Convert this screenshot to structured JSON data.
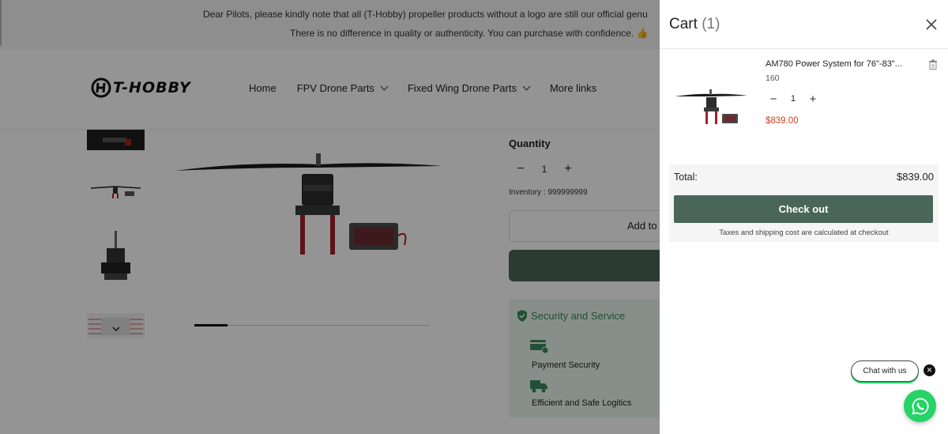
{
  "announcement": {
    "line1": "Dear Pilots, please kindly note that all (T-Hobby) propeller products without a logo are still our official genu",
    "line2": "There is no difference in quality or authenticity. You can purchase with confidence. 👍"
  },
  "header": {
    "logo_text": "T-HOBBY",
    "nav": [
      {
        "label": "Home"
      },
      {
        "label": "FPV Drone Parts"
      },
      {
        "label": "Fixed Wing Drone Parts"
      },
      {
        "label": "More links"
      }
    ]
  },
  "product": {
    "quantity_label": "Quantity",
    "quantity_value": "1",
    "minus": "−",
    "plus": "+",
    "inventory": "Inventory : 999999999",
    "add_to_cart": "Add to",
    "security_title": "Security and Service",
    "security_items": [
      "Payment Security",
      "Efficient and Safe Logitics"
    ]
  },
  "cart": {
    "title": "Cart",
    "count": "(1)",
    "item": {
      "name": "AM780 Power System for 76\"-83\"...",
      "variant": "160",
      "quantity": "1",
      "minus": "−",
      "plus": "+",
      "price": "$839.00"
    },
    "total_label": "Total:",
    "total_value": "$839.00",
    "checkout": "Check out",
    "tax_note": "Taxes and shipping cost are calculated at checkout"
  },
  "chat": {
    "label": "Chat with us",
    "close": "✕"
  },
  "colors": {
    "accent_green": "#4a6658",
    "price_red": "#d4421c",
    "whatsapp": "#25d366",
    "security_green": "#3a8a5a"
  }
}
